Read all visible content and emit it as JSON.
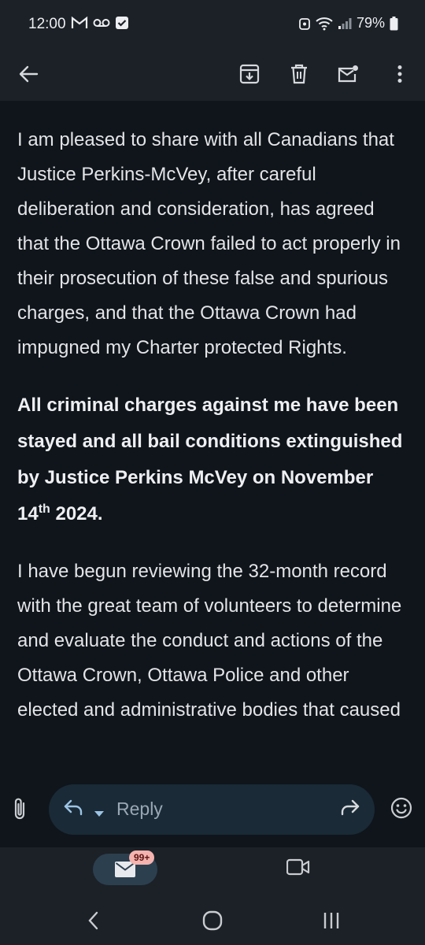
{
  "status_bar": {
    "time": "12:00",
    "battery": "79%",
    "left_icons": [
      "gmail-icon",
      "voicemail-icon",
      "checkbox-icon"
    ],
    "right_icons": [
      "alarm-icon",
      "wifi-icon",
      "signal-icon",
      "battery-icon"
    ]
  },
  "toolbar": {
    "icons": [
      "back-arrow-icon",
      "archive-icon",
      "delete-icon",
      "mark-unread-icon",
      "more-icon"
    ]
  },
  "email": {
    "paragraphs": [
      "I am pleased to share with all Canadians that Justice Perkins-McVey, after careful deliberation and consideration, has agreed that the Ottawa Crown failed to act properly in their prosecution of these false and spurious charges, and that the Ottawa Crown had impugned my Charter protected Rights.",
      "I have begun reviewing the 32-month record with the great team of volunteers to determine and evaluate the conduct and actions of the Ottawa Crown, Ottawa Police and other elected and administrative bodies that caused"
    ],
    "bold_paragraph": {
      "main": "All criminal charges against me have been stayed and all bail conditions extinguished by Justice Perkins McVey on November 14",
      "superscript": "th",
      "tail": " 2024."
    }
  },
  "reply_bar": {
    "label": "Reply",
    "icons": [
      "attach-icon",
      "reply-icon",
      "dropdown-caret-icon",
      "forward-icon",
      "emoji-icon"
    ]
  },
  "bottom_nav": {
    "mail_badge": "99+",
    "icons": [
      "mail-icon",
      "video-icon"
    ]
  },
  "system_nav": {
    "icons": [
      "back-icon",
      "home-icon",
      "recents-icon"
    ]
  },
  "colors": {
    "background": "#0f151b",
    "bar": "#1c2127",
    "reply_pill": "#1a2a37",
    "badge": "#f5b3b0",
    "text": "#e3e4e7"
  }
}
